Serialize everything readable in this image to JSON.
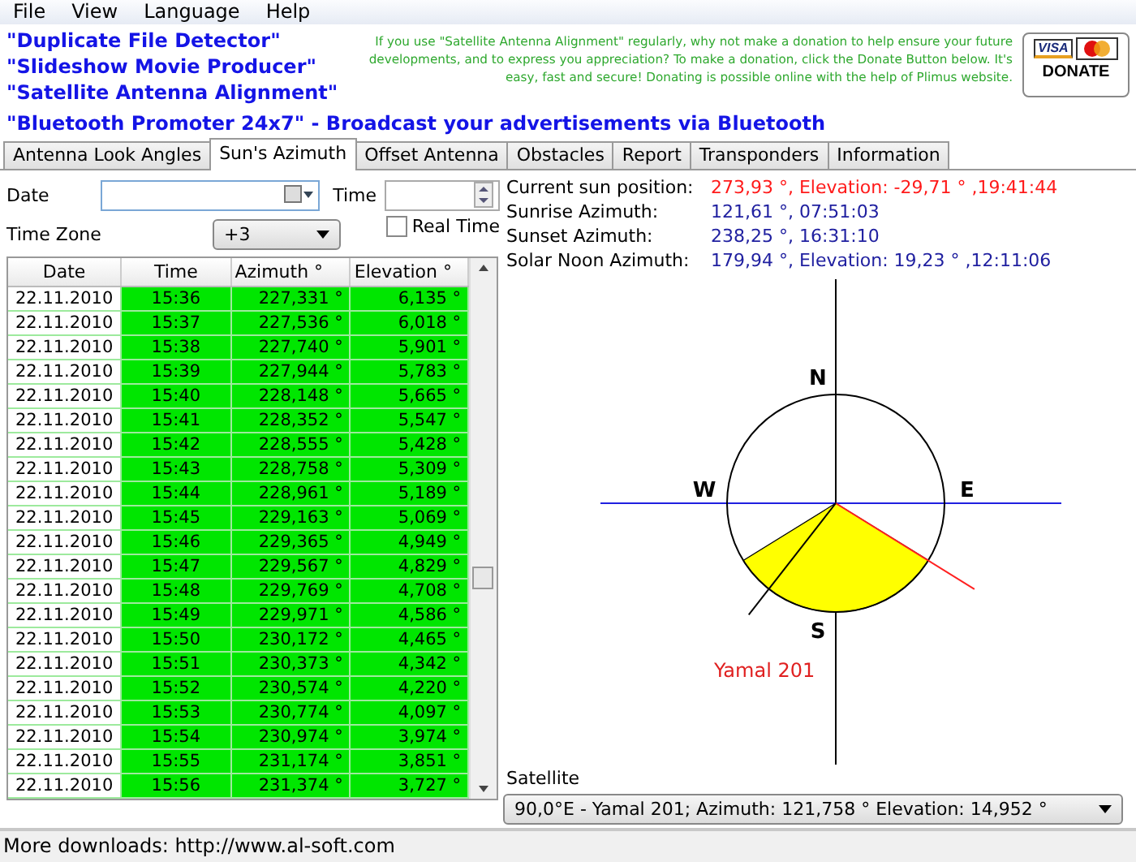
{
  "menu": [
    "File",
    "View",
    "Language",
    "Help"
  ],
  "banner": {
    "links": [
      "\"Duplicate File Detector\"",
      "\"Slideshow Movie Producer\"",
      "\"Satellite Antenna Alignment\"",
      "\"Bluetooth Promoter 24x7\" - Broadcast your advertisements via Bluetooth"
    ],
    "donation_text": "If you use \"Satellite Antenna Alignment\" regularly, why not make a donation to help ensure your future developments, and to express you appreciation? To make a donation, click the Donate Button below. It's easy, fast and secure! Donating is possible online with the help of Plimus website.",
    "card_label": "VISA",
    "donate_button": "DONATE"
  },
  "tabs": [
    {
      "label": "Antenna Look Angles",
      "selected": false
    },
    {
      "label": "Sun's Azimuth",
      "selected": true
    },
    {
      "label": "Offset Antenna",
      "selected": false
    },
    {
      "label": "Obstacles",
      "selected": false
    },
    {
      "label": "Report",
      "selected": false
    },
    {
      "label": "Transponders",
      "selected": false
    },
    {
      "label": "Information",
      "selected": false
    }
  ],
  "controls": {
    "date_label": "Date",
    "time_label": "Time",
    "timezone_label": "Time Zone",
    "timezone_value": "+3",
    "realtime_label": "Real Time",
    "realtime_checked": false
  },
  "table": {
    "columns": [
      "Date",
      "Time",
      "Azimuth °",
      "Elevation °"
    ],
    "rows": [
      [
        "22.11.2010",
        "15:36",
        "227,331 °",
        "6,135 °"
      ],
      [
        "22.11.2010",
        "15:37",
        "227,536 °",
        "6,018 °"
      ],
      [
        "22.11.2010",
        "15:38",
        "227,740 °",
        "5,901 °"
      ],
      [
        "22.11.2010",
        "15:39",
        "227,944 °",
        "5,783 °"
      ],
      [
        "22.11.2010",
        "15:40",
        "228,148 °",
        "5,665 °"
      ],
      [
        "22.11.2010",
        "15:41",
        "228,352 °",
        "5,547 °"
      ],
      [
        "22.11.2010",
        "15:42",
        "228,555 °",
        "5,428 °"
      ],
      [
        "22.11.2010",
        "15:43",
        "228,758 °",
        "5,309 °"
      ],
      [
        "22.11.2010",
        "15:44",
        "228,961 °",
        "5,189 °"
      ],
      [
        "22.11.2010",
        "15:45",
        "229,163 °",
        "5,069 °"
      ],
      [
        "22.11.2010",
        "15:46",
        "229,365 °",
        "4,949 °"
      ],
      [
        "22.11.2010",
        "15:47",
        "229,567 °",
        "4,829 °"
      ],
      [
        "22.11.2010",
        "15:48",
        "229,769 °",
        "4,708 °"
      ],
      [
        "22.11.2010",
        "15:49",
        "229,971 °",
        "4,586 °"
      ],
      [
        "22.11.2010",
        "15:50",
        "230,172 °",
        "4,465 °"
      ],
      [
        "22.11.2010",
        "15:51",
        "230,373 °",
        "4,342 °"
      ],
      [
        "22.11.2010",
        "15:52",
        "230,574 °",
        "4,220 °"
      ],
      [
        "22.11.2010",
        "15:53",
        "230,774 °",
        "4,097 °"
      ],
      [
        "22.11.2010",
        "15:54",
        "230,974 °",
        "3,974 °"
      ],
      [
        "22.11.2010",
        "15:55",
        "231,174 °",
        "3,851 °"
      ],
      [
        "22.11.2010",
        "15:56",
        "231,374 °",
        "3,727 °"
      ]
    ]
  },
  "info": [
    {
      "label": "Current sun position:",
      "value": "273,93 °, Elevation: -29,71 ° ,19:41:44",
      "kind": "current"
    },
    {
      "label": "Sunrise Azimuth:",
      "value": "121,61 °, 07:51:03",
      "kind": "normal"
    },
    {
      "label": "Sunset Azimuth:",
      "value": "238,25 °, 16:31:10",
      "kind": "normal"
    },
    {
      "label": "Solar Noon Azimuth:",
      "value": "179,94 °, Elevation: 19,23 ° ,12:11:06",
      "kind": "normal"
    }
  ],
  "compass": {
    "north": "N",
    "east": "E",
    "south": "S",
    "west": "W",
    "satellite_label": "Yamal 201"
  },
  "satellite": {
    "label": "Satellite",
    "value": "90,0°E - Yamal 201;  Azimuth: 121,758 °  Elevation: 14,952 °"
  },
  "status_bar": "More downloads: http://www.al-soft.com"
}
